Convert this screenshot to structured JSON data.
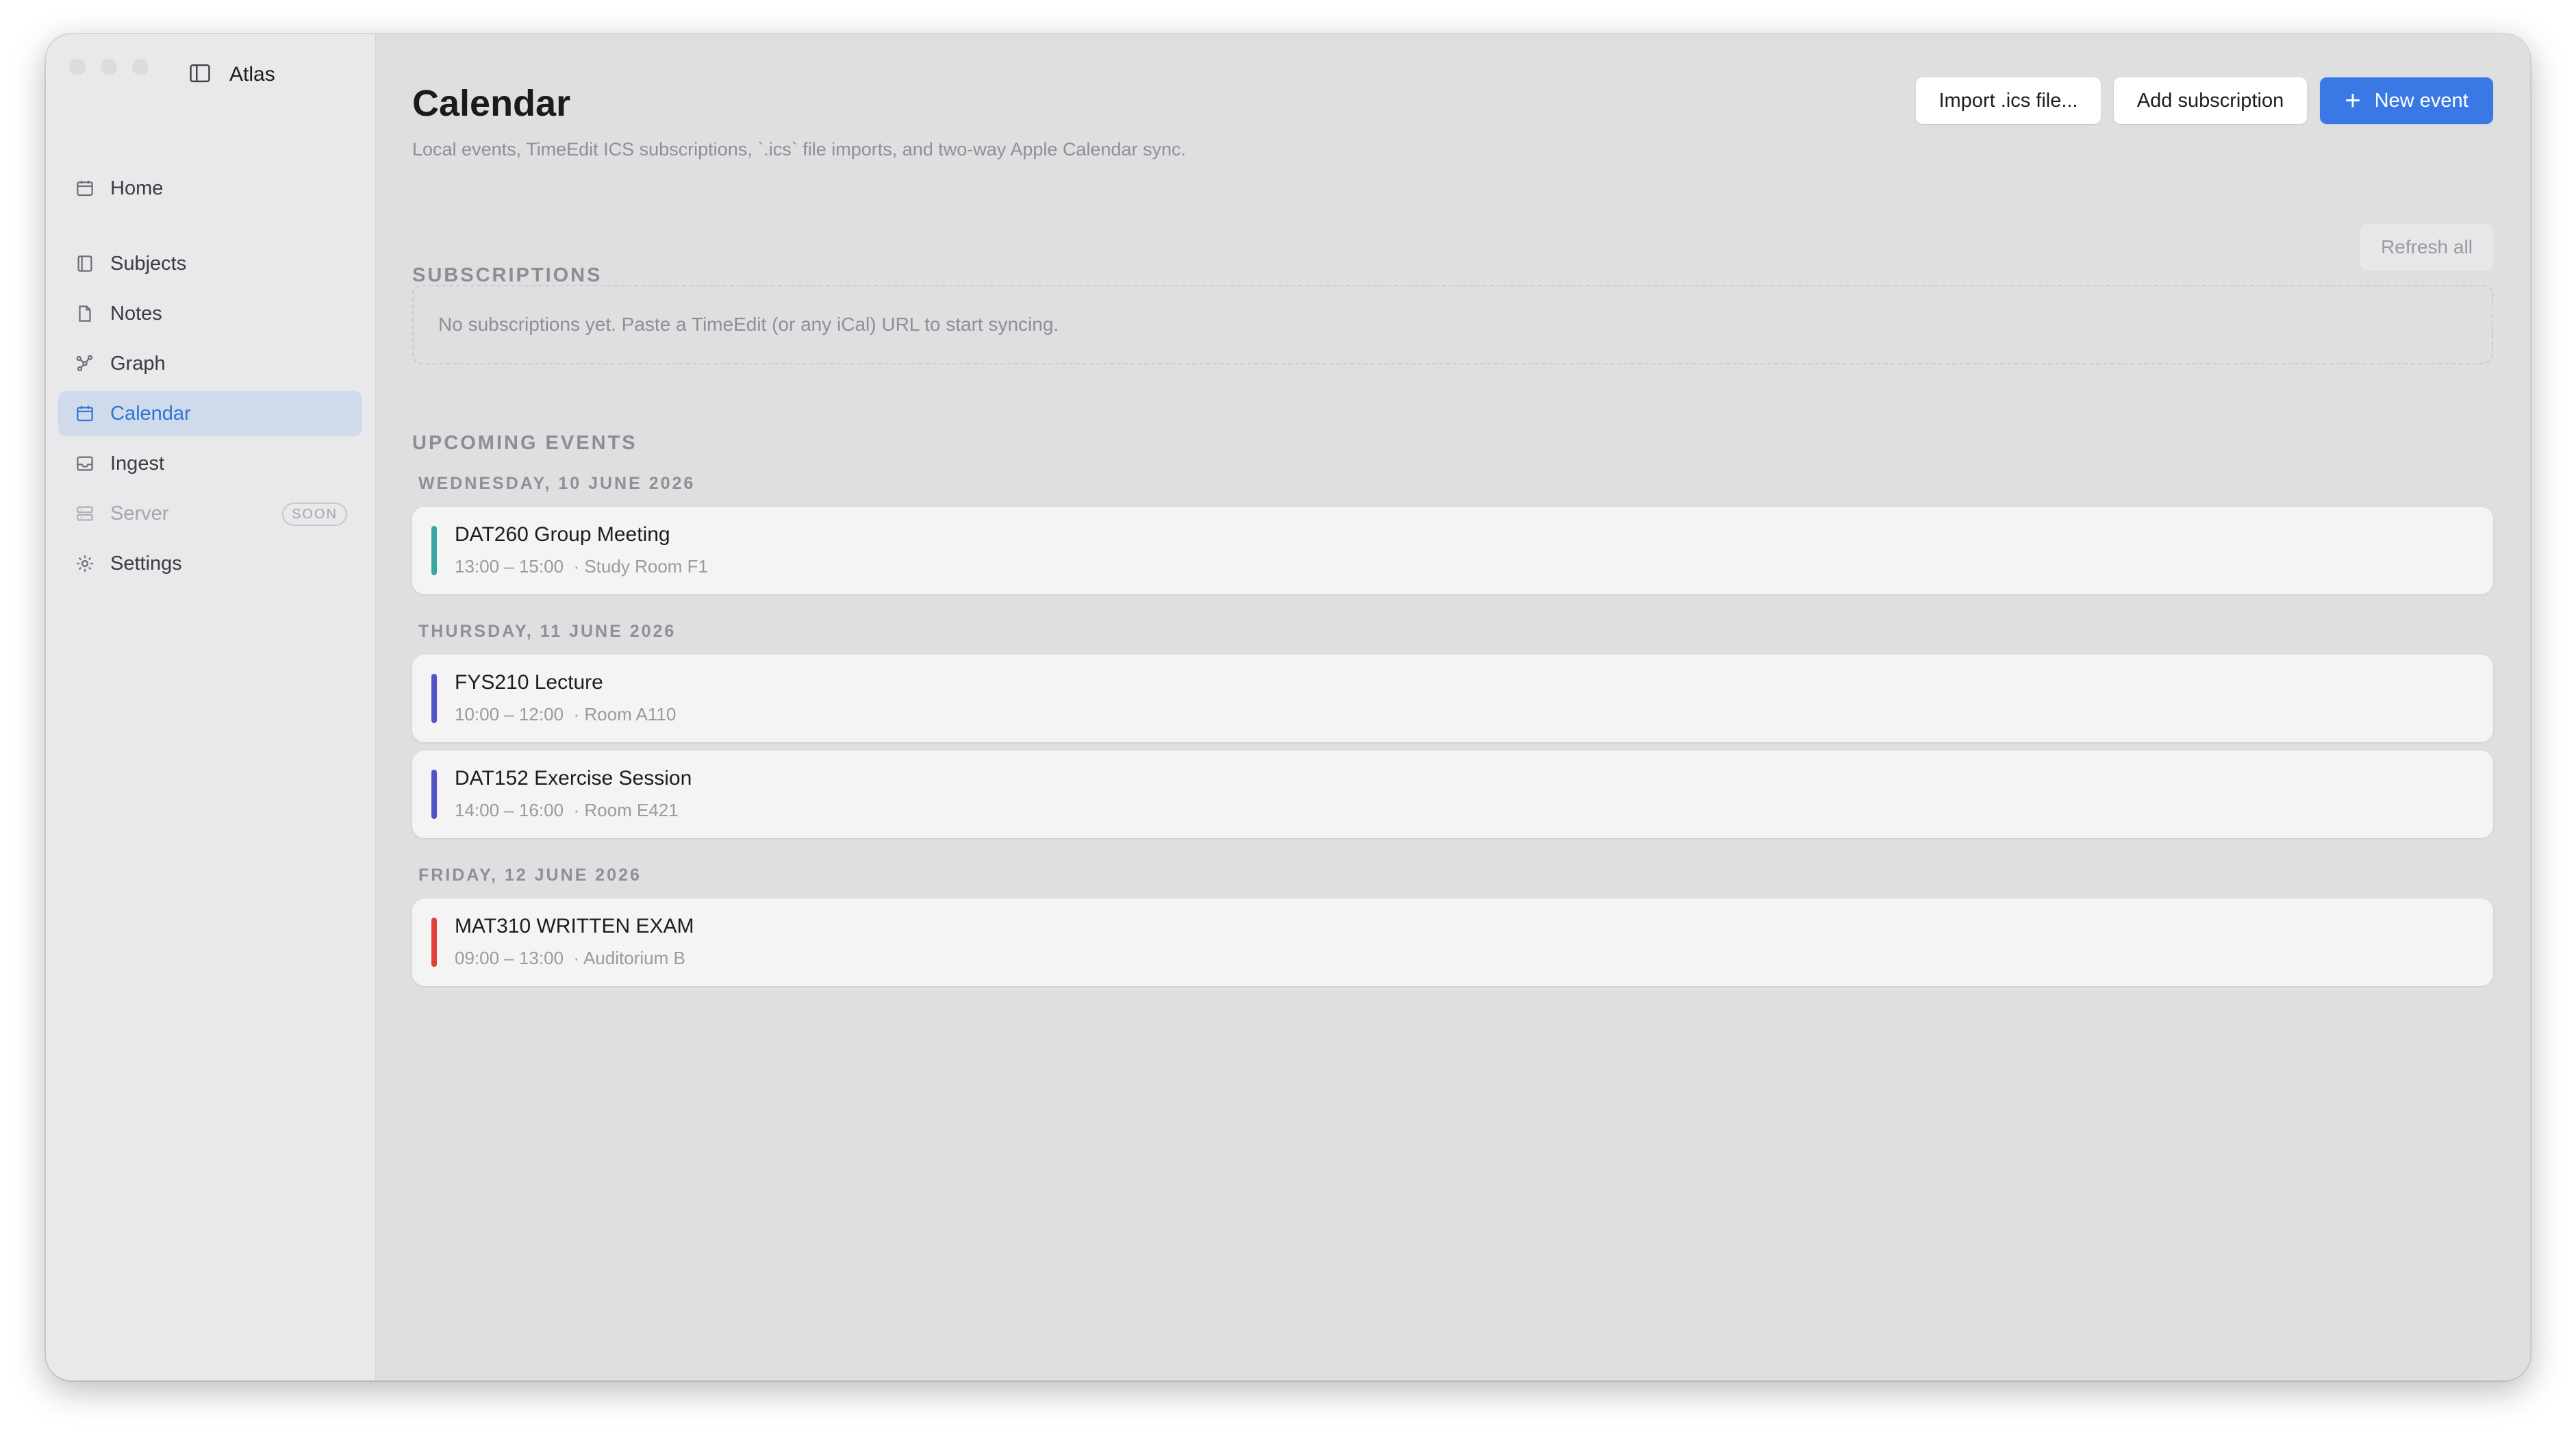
{
  "app": {
    "title": "Atlas"
  },
  "sidebar": {
    "items": [
      {
        "label": "Home",
        "icon": "calendar-icon"
      },
      {
        "label": "Subjects",
        "icon": "book-icon"
      },
      {
        "label": "Notes",
        "icon": "document-icon"
      },
      {
        "label": "Graph",
        "icon": "graph-icon"
      },
      {
        "label": "Calendar",
        "icon": "calendar-icon",
        "active": true
      },
      {
        "label": "Ingest",
        "icon": "inbox-icon"
      },
      {
        "label": "Server",
        "icon": "server-icon",
        "badge": "SOON",
        "disabled": true
      },
      {
        "label": "Settings",
        "icon": "gear-icon"
      }
    ]
  },
  "header": {
    "title": "Calendar",
    "subtitle": "Local events, TimeEdit ICS subscriptions, `.ics` file imports, and two-way Apple Calendar sync.",
    "import_label": "Import .ics file...",
    "add_subscription_label": "Add subscription",
    "new_event_label": "New event"
  },
  "subscriptions": {
    "heading": "SUBSCRIPTIONS",
    "refresh_label": "Refresh all",
    "empty_text": "No subscriptions yet. Paste a TimeEdit (or any iCal) URL to start syncing."
  },
  "upcoming": {
    "heading": "UPCOMING EVENTS",
    "days": [
      {
        "label": "WEDNESDAY, 10 JUNE 2026",
        "events": [
          {
            "title": "DAT260 Group Meeting",
            "time": "13:00 – 15:00",
            "location": "· Study Room F1",
            "color": "#3aa6a6"
          }
        ]
      },
      {
        "label": "THURSDAY, 11 JUNE 2026",
        "events": [
          {
            "title": "FYS210 Lecture",
            "time": "10:00 – 12:00",
            "location": "· Room A110",
            "color": "#5154c7"
          },
          {
            "title": "DAT152 Exercise Session",
            "time": "14:00 – 16:00",
            "location": "· Room E421",
            "color": "#5154c7"
          }
        ]
      },
      {
        "label": "FRIDAY, 12 JUNE 2026",
        "events": [
          {
            "title": "MAT310 WRITTEN EXAM",
            "time": "09:00 – 13:00",
            "location": "· Auditorium B",
            "color": "#e0403a"
          }
        ]
      }
    ]
  },
  "colors": {
    "accent": "#3a78e6",
    "active_bg": "#cfdbea",
    "active_text": "#2f74d8"
  }
}
